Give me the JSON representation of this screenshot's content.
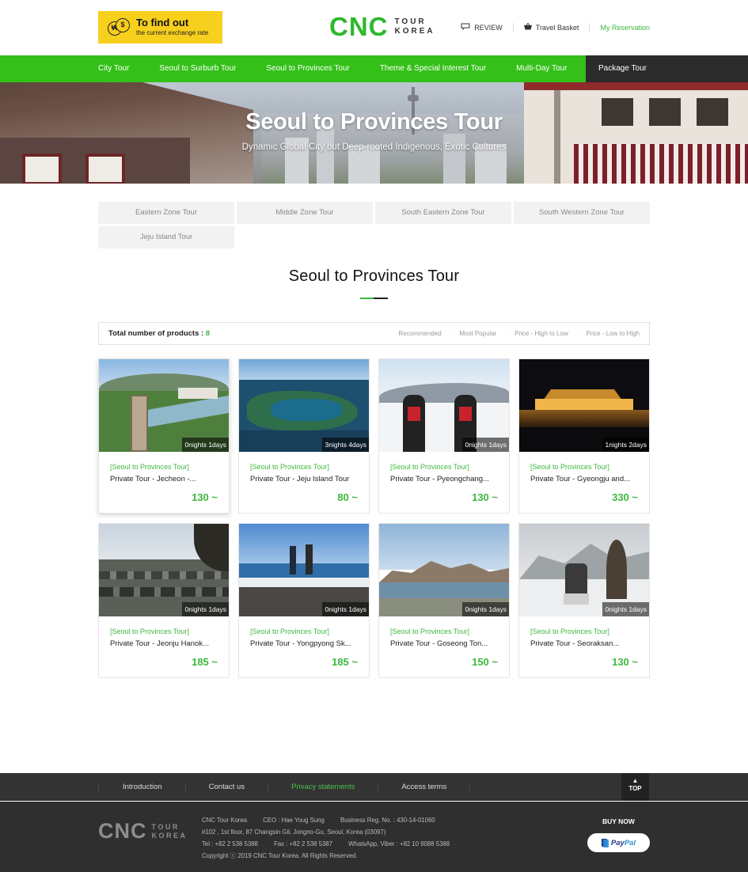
{
  "header": {
    "exchange": {
      "title": "To find out",
      "subtitle": "the current exchange rate",
      "coin_a": "₩",
      "coin_b": "$"
    },
    "logo": {
      "main": "CNC",
      "sub1": "TOUR",
      "sub2": "KOREA"
    },
    "util": [
      {
        "label": "REVIEW",
        "icon": "speech-bubble-icon"
      },
      {
        "label": "Travel Basket",
        "icon": "basket-icon"
      },
      {
        "label": "My Reservation"
      }
    ]
  },
  "nav": {
    "items": [
      "City Tour",
      "Seoul to Surburb Tour",
      "Seoul to Provinces Tour",
      "Theme & Special Interest Tour",
      "Multi-Day Tour"
    ],
    "active": "Package Tour"
  },
  "hero": {
    "title": "Seoul to Provinces Tour",
    "subtitle": "Dynamic Global City but Deep-rooted Indigenous, Exotic Cultures"
  },
  "zones": [
    "Eastern Zone Tour",
    "Middle Zone Tour",
    "South Eastern Zone Tour",
    "South Western Zone Tour",
    "Jeju Island Tour"
  ],
  "section": {
    "title": "Seoul to Provinces Tour"
  },
  "sortbar": {
    "total_label": "Total number of products :",
    "total_count": "8",
    "sorts": [
      "Recommended",
      "Most Popular",
      "Price - High to Low",
      "Price - Low to High"
    ]
  },
  "products": [
    {
      "category": "[Seoul to Provinces Tour]",
      "name": "Private Tour - Jecheon -...",
      "price": "130 ~",
      "duration": "0nights 1days"
    },
    {
      "category": "[Seoul to Provinces Tour]",
      "name": "Private Tour - Jeju Island Tour",
      "price": "80 ~",
      "duration": "3nights 4days"
    },
    {
      "category": "[Seoul to Provinces Tour]",
      "name": "Private Tour - Pyeongchang...",
      "price": "130 ~",
      "duration": "0nights 1days"
    },
    {
      "category": "[Seoul to Provinces Tour]",
      "name": "Private Tour - Gyeongju and...",
      "price": "330 ~",
      "duration": "1nights 2days"
    },
    {
      "category": "[Seoul to Provinces Tour]",
      "name": "Private Tour - Jeonju Hanok...",
      "price": "185 ~",
      "duration": "0nights 1days"
    },
    {
      "category": "[Seoul to Provinces Tour]",
      "name": "Private Tour - Yongpyong Sk...",
      "price": "185 ~",
      "duration": "0nights 1days"
    },
    {
      "category": "[Seoul to Provinces Tour]",
      "name": "Private Tour - Goseong Ton...",
      "price": "150 ~",
      "duration": "0nights 1days"
    },
    {
      "category": "[Seoul to Provinces Tour]",
      "name": "Private Tour - Seoraksan...",
      "price": "130 ~",
      "duration": "0nights 1days"
    }
  ],
  "footer": {
    "links": [
      "Introduction",
      "Contact us",
      "Privacy statements",
      "Access terms"
    ],
    "top_label": "TOP",
    "logo": {
      "main": "CNC",
      "sub1": "TOUR",
      "sub2": "KOREA"
    },
    "info": {
      "company": "CNC Tour Korea",
      "ceo": "CEO : Hae Youg Sung",
      "bizreg": "Business Reg. No. : 430-14-01060",
      "address": "#102 , 1st floor, 87 Changsin Gil, Jongno-Gu, Seoul, Korea (03097)",
      "tel": "Tel : +82 2 538 5388",
      "fax": "Fax : +82 2 538 5387",
      "whatsapp": "WhatsApp, Viber : +82 10 9088 5388",
      "copyright": "Copyright ⓒ 2019 CNC Tour Korea. All Rights Reserved."
    },
    "buy_now": "BUY NOW",
    "paypal": {
      "p1": "Pay",
      "p2": "Pal"
    }
  },
  "colors": {
    "brand_green": "#34c018",
    "accent_green": "#3db83d",
    "yellow": "#f7cf1d",
    "dark": "#2b2b2b"
  }
}
